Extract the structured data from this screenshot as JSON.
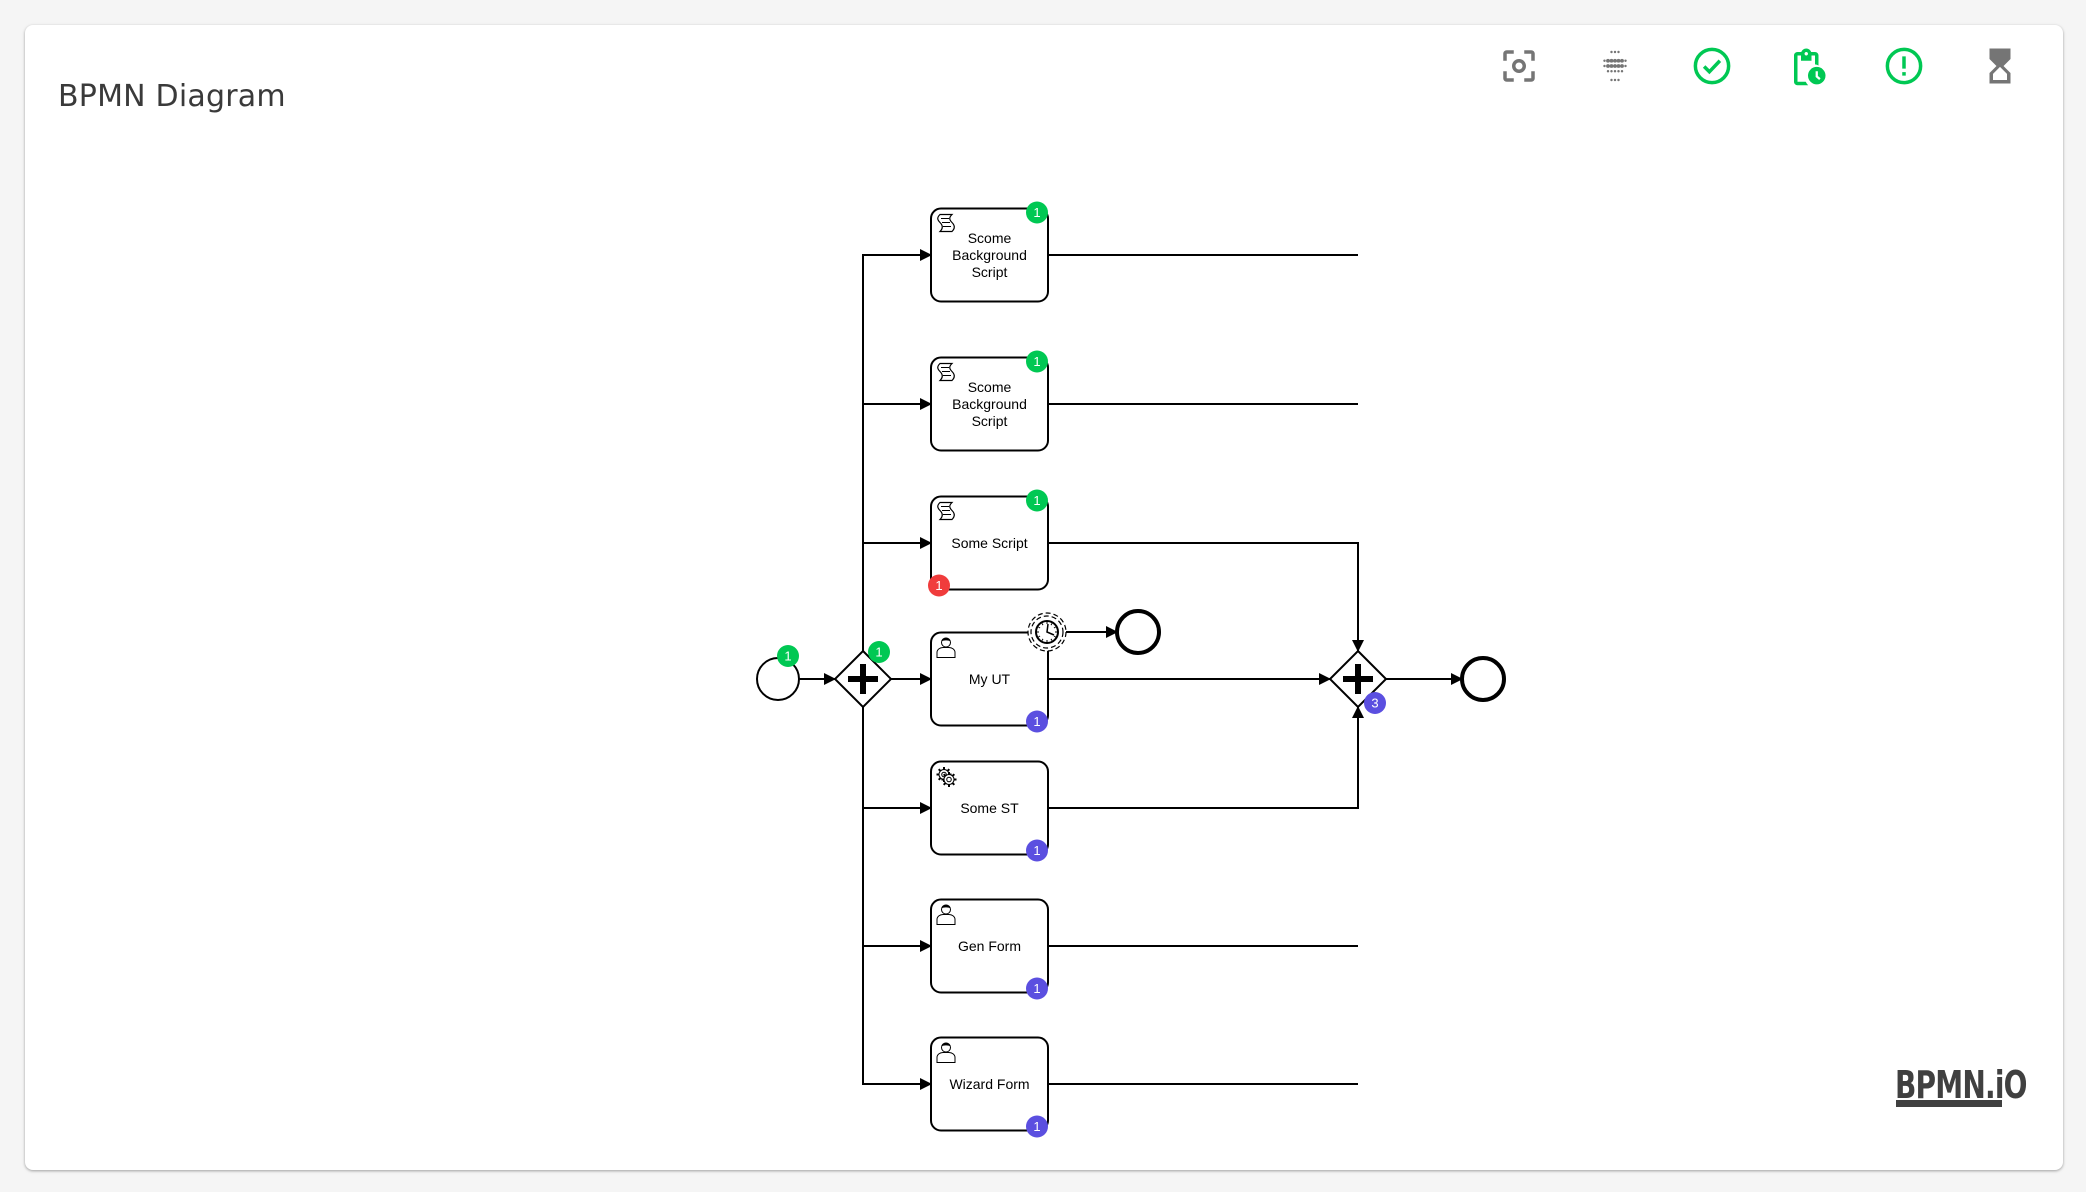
{
  "header": {
    "title": "BPMN Diagram"
  },
  "toolbar": [
    {
      "name": "fit-view-button",
      "icon": "focus-icon",
      "color": "#757575"
    },
    {
      "name": "heatmap-button",
      "icon": "dots-grid-icon",
      "color": "#757575"
    },
    {
      "name": "completed-filter-button",
      "icon": "check-circle-icon",
      "color": "#00c853"
    },
    {
      "name": "pending-filter-button",
      "icon": "clipboard-clock-icon",
      "color": "#00c853"
    },
    {
      "name": "errors-filter-button",
      "icon": "alert-circle-icon",
      "color": "#00c853"
    },
    {
      "name": "waiting-filter-button",
      "icon": "hourglass-icon",
      "color": "#757575"
    }
  ],
  "colors": {
    "completed": "#00c853",
    "active": "#5b4fe0",
    "error": "#f03c3c",
    "stroke": "#000000"
  },
  "diagram": {
    "start_event": {
      "badge_completed": "1"
    },
    "split_gateway": {
      "type": "parallel",
      "badge_completed": "1"
    },
    "join_gateway": {
      "type": "parallel",
      "badge_active": "3"
    },
    "tasks": [
      {
        "name": "Scome Background Script",
        "lines": [
          "Scome",
          "Background",
          "Script"
        ],
        "type": "script",
        "completed": "1"
      },
      {
        "name": "Scome Background Script",
        "lines": [
          "Scome",
          "Background",
          "Script"
        ],
        "type": "script",
        "completed": "1"
      },
      {
        "name": "Some Script",
        "lines": [
          "Some Script"
        ],
        "type": "script",
        "completed": "1",
        "error": "1"
      },
      {
        "name": "My UT",
        "lines": [
          "My UT"
        ],
        "type": "user",
        "active": "1",
        "boundary": "timer"
      },
      {
        "name": "Some ST",
        "lines": [
          "Some ST"
        ],
        "type": "service",
        "active": "1"
      },
      {
        "name": "Gen Form",
        "lines": [
          "Gen Form"
        ],
        "type": "user",
        "active": "1"
      },
      {
        "name": "Wizard Form",
        "lines": [
          "Wizard Form"
        ],
        "type": "user",
        "active": "1"
      }
    ]
  },
  "watermark": {
    "text": "BPMN.iO"
  }
}
